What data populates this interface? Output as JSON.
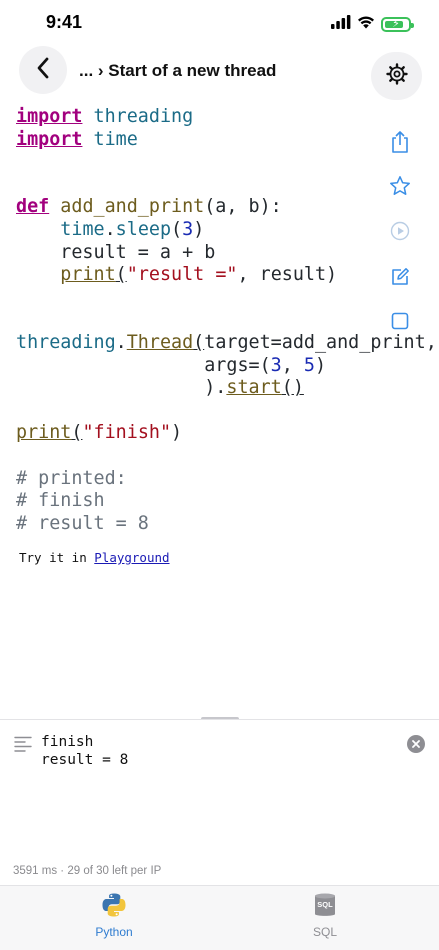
{
  "status_bar": {
    "time": "9:41"
  },
  "header": {
    "breadcrumb": "... › Start of a new thread"
  },
  "code_lines": [
    [
      {
        "t": "import",
        "c": "kw"
      },
      {
        "t": " "
      },
      {
        "t": "threading",
        "c": "mod"
      }
    ],
    [
      {
        "t": "import",
        "c": "kw"
      },
      {
        "t": " "
      },
      {
        "t": "time",
        "c": "mod"
      }
    ],
    [],
    [],
    [
      {
        "t": "def",
        "c": "kw"
      },
      {
        "t": " "
      },
      {
        "t": "add_and_print",
        "c": "fn"
      },
      {
        "t": "(a, b):"
      }
    ],
    [
      {
        "t": "    "
      },
      {
        "t": "time",
        "c": "mod"
      },
      {
        "t": "."
      },
      {
        "t": "sleep",
        "c": "mod"
      },
      {
        "t": "("
      },
      {
        "t": "3",
        "c": "num"
      },
      {
        "t": ")"
      }
    ],
    [
      {
        "t": "    result = a + b"
      }
    ],
    [
      {
        "t": "    "
      },
      {
        "t": "print",
        "c": "fnu"
      },
      {
        "t": "(",
        "c": "pu"
      },
      {
        "t": "\"result =\"",
        "c": "str"
      },
      {
        "t": ", result)"
      }
    ],
    [],
    [],
    [
      {
        "t": "threading",
        "c": "mod"
      },
      {
        "t": "."
      },
      {
        "t": "Thread",
        "c": "fnu"
      },
      {
        "t": "(",
        "c": "pu"
      },
      {
        "t": "target=add_and_print,"
      }
    ],
    [
      {
        "t": "                 args=("
      },
      {
        "t": "3",
        "c": "num"
      },
      {
        "t": ", "
      },
      {
        "t": "5",
        "c": "num"
      },
      {
        "t": ")"
      }
    ],
    [
      {
        "t": "                 )."
      },
      {
        "t": "start",
        "c": "fnu"
      },
      {
        "t": "()",
        "c": "pu"
      }
    ],
    [],
    [
      {
        "t": "print",
        "c": "fnu"
      },
      {
        "t": "(",
        "c": "pu"
      },
      {
        "t": "\"finish\"",
        "c": "str"
      },
      {
        "t": ")"
      }
    ],
    [],
    [
      {
        "t": "# printed:",
        "c": "cm"
      }
    ],
    [
      {
        "t": "# finish",
        "c": "cm"
      }
    ],
    [
      {
        "t": "# result = 8",
        "c": "cm"
      }
    ]
  ],
  "try_it": {
    "prefix": "Try it in ",
    "link": "Playground"
  },
  "output": {
    "text": "finish\nresult = 8"
  },
  "meta": {
    "text": "3591 ms · 29 of 30 left per IP"
  },
  "tabs": [
    {
      "label": "Python",
      "icon": "python-icon",
      "active": true
    },
    {
      "label": "SQL",
      "icon": "sql-database-icon",
      "active": false
    }
  ],
  "colors": {
    "accent": "#2f7cd0",
    "action_icon": "#3a8ee6",
    "battery": "#3bc15a",
    "keyword": "#a2007e",
    "string": "#a30f1e",
    "number": "#1a2bb3"
  }
}
